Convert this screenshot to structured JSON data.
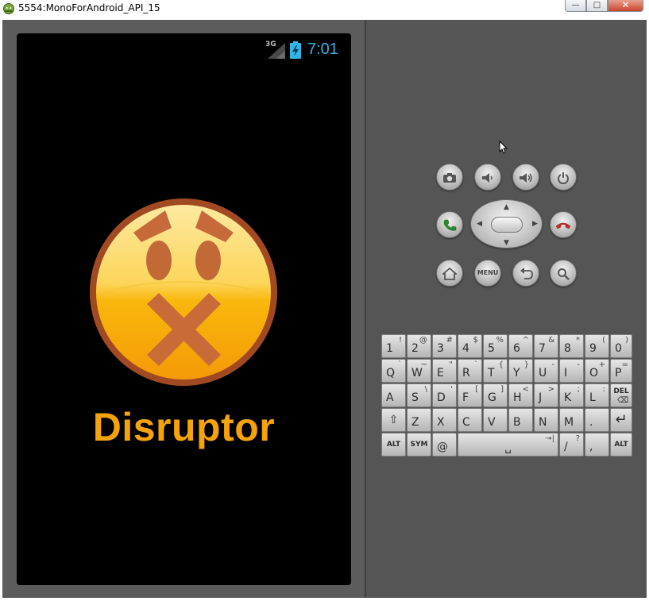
{
  "window": {
    "title": "5554:MonoForAndroid_API_15",
    "minimize_label": "—",
    "maximize_label": "□",
    "close_label": "✕"
  },
  "statusbar": {
    "network_label": "3G",
    "time": "7:01",
    "time_color": "#34b5e5"
  },
  "app": {
    "name": "Disruptor",
    "name_color": "#f5a30d",
    "logo_icon": "x-mouth-emoji-icon"
  },
  "hardware_buttons": {
    "camera": "camera-icon",
    "volume_down": "volume-down-icon",
    "volume_up": "volume-up-icon",
    "power": "power-icon",
    "call": "call-icon",
    "end_call": "end-call-icon",
    "home": "home-icon",
    "menu_label": "MENU",
    "back": "back-icon",
    "search": "search-icon"
  },
  "keyboard": {
    "rows": [
      [
        {
          "main": "1",
          "sub": "!"
        },
        {
          "main": "2",
          "sub": "@"
        },
        {
          "main": "3",
          "sub": "#"
        },
        {
          "main": "4",
          "sub": "$"
        },
        {
          "main": "5",
          "sub": "%"
        },
        {
          "main": "6",
          "sub": "^"
        },
        {
          "main": "7",
          "sub": "&"
        },
        {
          "main": "8",
          "sub": "*"
        },
        {
          "main": "9",
          "sub": "("
        },
        {
          "main": "0",
          "sub": ")"
        }
      ],
      [
        {
          "main": "Q",
          "sub": "`"
        },
        {
          "main": "W",
          "sub": "~"
        },
        {
          "main": "E",
          "sub": "\""
        },
        {
          "main": "R",
          "sub": "`"
        },
        {
          "main": "T",
          "sub": "{"
        },
        {
          "main": "Y",
          "sub": "}"
        },
        {
          "main": "U",
          "sub": "-"
        },
        {
          "main": "I",
          "sub": "-"
        },
        {
          "main": "O",
          "sub": "+"
        },
        {
          "main": "P",
          "sub": "="
        }
      ],
      [
        {
          "main": "A",
          "sub": ""
        },
        {
          "main": "S",
          "sub": "\\"
        },
        {
          "main": "D",
          "sub": "'"
        },
        {
          "main": "F",
          "sub": "["
        },
        {
          "main": "G",
          "sub": "]"
        },
        {
          "main": "H",
          "sub": "<"
        },
        {
          "main": "J",
          "sub": ">"
        },
        {
          "main": "K",
          "sub": ";"
        },
        {
          "main": "L",
          "sub": ":"
        },
        {
          "main": "DEL",
          "sub": ""
        }
      ],
      [
        {
          "main": "⇧",
          "sub": ""
        },
        {
          "main": "Z",
          "sub": ""
        },
        {
          "main": "X",
          "sub": ""
        },
        {
          "main": "C",
          "sub": ""
        },
        {
          "main": "V",
          "sub": ""
        },
        {
          "main": "B",
          "sub": ""
        },
        {
          "main": "N",
          "sub": ""
        },
        {
          "main": "M",
          "sub": ""
        },
        {
          "main": ".",
          "sub": ""
        },
        {
          "main": "↵",
          "sub": ""
        }
      ]
    ],
    "bottom": {
      "alt_left": "ALT",
      "sym": "SYM",
      "at": "@",
      "space_sub": "→|",
      "space_main": "␣",
      "slash_main": "/",
      "slash_sub": "?",
      "comma": ",",
      "alt_right": "ALT"
    }
  }
}
